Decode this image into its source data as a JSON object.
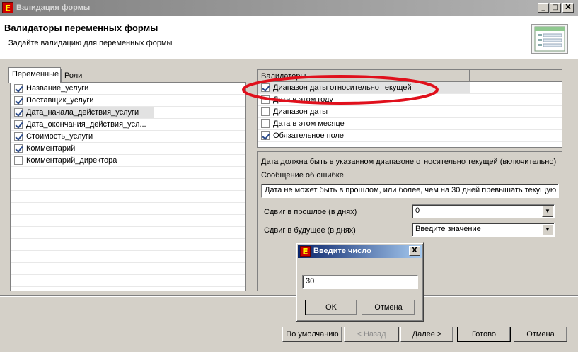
{
  "window": {
    "title": "Валидация формы",
    "icon_letter": "E",
    "controls": {
      "minimize": "_",
      "maximize": "□",
      "close": "X"
    }
  },
  "header": {
    "title": "Валидаторы переменных формы",
    "subtitle": "Задайте валидацию для переменных формы",
    "icon": "form-validation-icon"
  },
  "left_tabs": [
    {
      "label": "Переменные",
      "active": true
    },
    {
      "label": "Роли",
      "active": false
    }
  ],
  "variables": [
    {
      "label": "Название_услуги",
      "checked": true,
      "selected": false
    },
    {
      "label": "Поставщик_услуги",
      "checked": true,
      "selected": false
    },
    {
      "label": "Дата_начала_действия_услуги",
      "checked": true,
      "selected": true
    },
    {
      "label": "Дата_окончания_действия_усл...",
      "checked": true,
      "selected": false
    },
    {
      "label": "Стоимость_услуги",
      "checked": true,
      "selected": false
    },
    {
      "label": "Комментарий",
      "checked": true,
      "selected": false
    },
    {
      "label": "Комментарий_директора",
      "checked": false,
      "selected": false
    }
  ],
  "validators": {
    "header": "Валидаторы",
    "items": [
      {
        "label": "Диапазон даты относительно текущей",
        "checked": true,
        "selected": true
      },
      {
        "label": "Дата в этом году",
        "checked": false,
        "selected": false
      },
      {
        "label": "Диапазон даты",
        "checked": false,
        "selected": false
      },
      {
        "label": "Дата в этом месяце",
        "checked": false,
        "selected": false
      },
      {
        "label": "Обязательное поле",
        "checked": true,
        "selected": false
      }
    ]
  },
  "details": {
    "description": "Дата должна быть в указанном диапазоне относительно текущей (включительно)",
    "error_label": "Сообщение об ошибке",
    "error_value": "Дата не может быть в прошлом, или более, чем на 30 дней превышать текущую",
    "past_label": "Сдвиг в прошлое (в днях)",
    "past_value": "0",
    "future_label": "Сдвиг в будущее (в днях)",
    "future_value": "Введите значение"
  },
  "dialog": {
    "title": "Введите число",
    "value": "30",
    "ok": "OK",
    "cancel": "Отмена",
    "close": "X"
  },
  "footer": {
    "defaults": "По умолчанию",
    "back": "< Назад",
    "next": "Далее >",
    "finish": "Готово",
    "cancel": "Отмена"
  },
  "colors": {
    "annotation": "#e0101c",
    "dialog_title": "#0a246a"
  }
}
